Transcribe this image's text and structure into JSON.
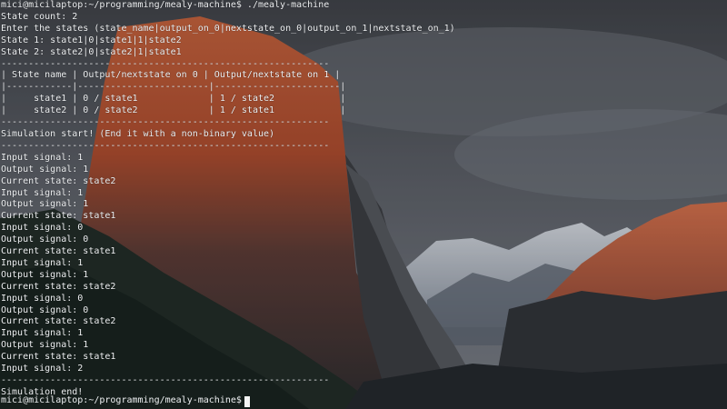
{
  "terminal": {
    "lines": [
      "mici@micilaptop:~/programming/mealy-machine$ ./mealy-machine",
      "State count: 2",
      "Enter the states (state_name|output_on_0|nextstate_on_0|output_on_1|nextstate_on_1)",
      "State 1: state1|0|state1|1|state2",
      "State 2: state2|0|state2|1|state1",
      "------------------------------------------------------------",
      "| State name | Output/nextstate on 0 | Output/nextstate on 1 |",
      "|------------|------------------------|-----------------------|",
      "|     state1 | 0 / state1             | 1 / state2            |",
      "|     state2 | 0 / state2             | 1 / state1            |",
      "------------------------------------------------------------",
      "Simulation start! (End it with a non-binary value)",
      "------------------------------------------------------------",
      "Input signal: 1",
      "Output signal: 1",
      "Current state: state2",
      "Input signal: 1",
      "Output signal: 1",
      "Current state: state1",
      "Input signal: 0",
      "Output signal: 0",
      "Current state: state1",
      "Input signal: 1",
      "Output signal: 1",
      "Current state: state2",
      "Input signal: 0",
      "Output signal: 0",
      "Current state: state2",
      "Input signal: 1",
      "Output signal: 1",
      "Current state: state1",
      "Input signal: 2",
      "------------------------------------------------------------",
      "Simulation end!"
    ],
    "prompt": "mici@micilaptop:~/programming/mealy-machine$"
  }
}
